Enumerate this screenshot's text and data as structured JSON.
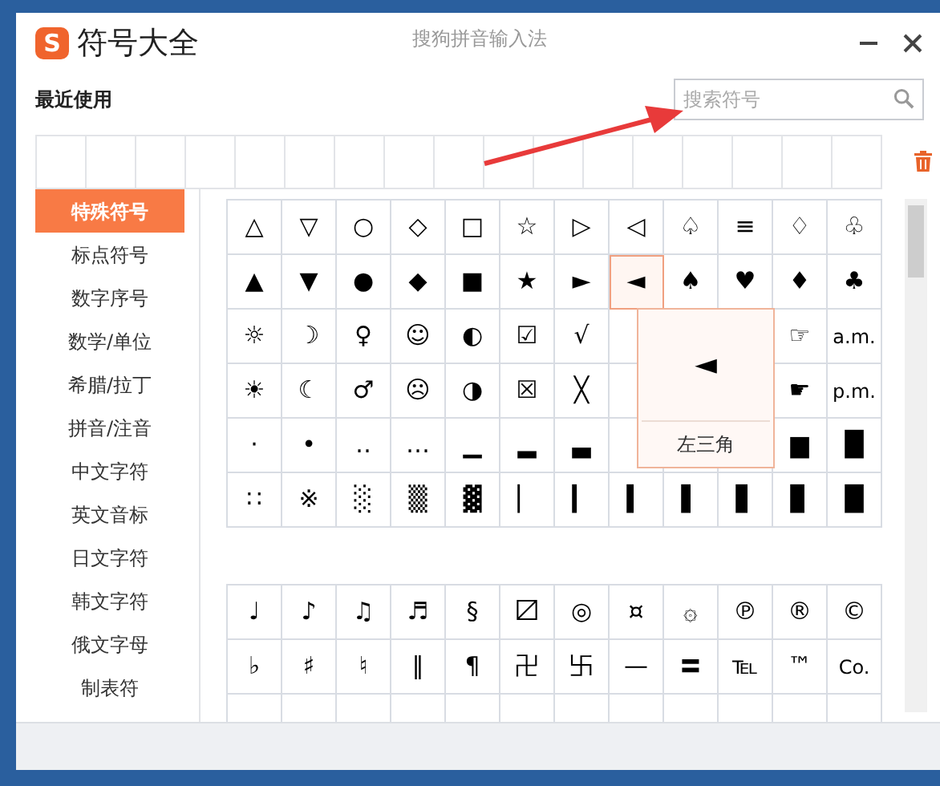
{
  "window": {
    "logo": "S",
    "title": "符号大全",
    "app_name": "搜狗拼音输入法"
  },
  "recent": {
    "label": "最近使用"
  },
  "search": {
    "placeholder": "搜索符号"
  },
  "categories": [
    {
      "label": "特殊符号",
      "selected": true
    },
    {
      "label": "标点符号",
      "selected": false
    },
    {
      "label": "数字序号",
      "selected": false
    },
    {
      "label": "数学/单位",
      "selected": false
    },
    {
      "label": "希腊/拉丁",
      "selected": false
    },
    {
      "label": "拼音/注音",
      "selected": false
    },
    {
      "label": "中文字符",
      "selected": false
    },
    {
      "label": "英文音标",
      "selected": false
    },
    {
      "label": "日文字符",
      "selected": false
    },
    {
      "label": "韩文字符",
      "selected": false
    },
    {
      "label": "俄文字母",
      "selected": false
    },
    {
      "label": "制表符",
      "selected": false
    }
  ],
  "grids": [
    {
      "rows": [
        [
          {
            "symbol": "△",
            "selected": false
          },
          {
            "symbol": "▽",
            "selected": false
          },
          {
            "symbol": "○",
            "selected": false
          },
          {
            "symbol": "◇",
            "selected": false
          },
          {
            "symbol": "□",
            "selected": false
          },
          {
            "symbol": "☆",
            "selected": false
          },
          {
            "symbol": "▷",
            "selected": false
          },
          {
            "symbol": "◁",
            "selected": false
          },
          {
            "symbol": "♤",
            "selected": false
          },
          {
            "symbol": "≡",
            "selected": false
          },
          {
            "symbol": "♢",
            "selected": false
          },
          {
            "symbol": "♧",
            "selected": false
          }
        ],
        [
          {
            "symbol": "▲",
            "selected": false
          },
          {
            "symbol": "▼",
            "selected": false
          },
          {
            "symbol": "●",
            "selected": false
          },
          {
            "symbol": "◆",
            "selected": false
          },
          {
            "symbol": "■",
            "selected": false
          },
          {
            "symbol": "★",
            "selected": false
          },
          {
            "symbol": "►",
            "selected": false
          },
          {
            "symbol": "◄",
            "selected": true
          },
          {
            "symbol": "♠",
            "selected": false
          },
          {
            "symbol": "♥",
            "selected": false
          },
          {
            "symbol": "♦",
            "selected": false
          },
          {
            "symbol": "♣",
            "selected": false
          }
        ],
        [
          {
            "symbol": "☼",
            "selected": false
          },
          {
            "symbol": "☽",
            "selected": false
          },
          {
            "symbol": "♀",
            "selected": false
          },
          {
            "symbol": "☺",
            "selected": false
          },
          {
            "symbol": "◐",
            "selected": false
          },
          {
            "symbol": "☑",
            "selected": false
          },
          {
            "symbol": "√",
            "selected": false
          },
          null,
          null,
          null,
          {
            "symbol": "☞",
            "selected": false
          },
          {
            "symbol": "a.m.",
            "selected": false
          }
        ],
        [
          {
            "symbol": "☀",
            "selected": false
          },
          {
            "symbol": "☾",
            "selected": false
          },
          {
            "symbol": "♂",
            "selected": false
          },
          {
            "symbol": "☹",
            "selected": false
          },
          {
            "symbol": "◑",
            "selected": false
          },
          {
            "symbol": "☒",
            "selected": false
          },
          {
            "symbol": "╳",
            "selected": false
          },
          null,
          null,
          null,
          {
            "symbol": "☛",
            "selected": false
          },
          {
            "symbol": "p.m.",
            "selected": false
          }
        ],
        [
          {
            "symbol": "·",
            "selected": false
          },
          {
            "symbol": "•",
            "selected": false
          },
          {
            "symbol": "‥",
            "selected": false
          },
          {
            "symbol": "…",
            "selected": false
          },
          {
            "symbol": "▁",
            "selected": false
          },
          {
            "symbol": "▂",
            "selected": false
          },
          {
            "symbol": "▃",
            "selected": false
          },
          null,
          null,
          null,
          {
            "symbol": "▆",
            "selected": false
          },
          {
            "symbol": "█",
            "selected": false
          }
        ],
        [
          {
            "symbol": "∷",
            "selected": false
          },
          {
            "symbol": "※",
            "selected": false
          },
          {
            "symbol": "░",
            "selected": false
          },
          {
            "symbol": "▒",
            "selected": false
          },
          {
            "symbol": "▓",
            "selected": false
          },
          {
            "symbol": "▏",
            "selected": false
          },
          {
            "symbol": "▎",
            "selected": false
          },
          {
            "symbol": "▍",
            "selected": false
          },
          {
            "symbol": "▌",
            "selected": false
          },
          {
            "symbol": "▋",
            "selected": false
          },
          {
            "symbol": "▊",
            "selected": false
          },
          {
            "symbol": "█",
            "selected": false
          }
        ]
      ]
    },
    {
      "rows": [
        [
          {
            "symbol": "♩",
            "selected": false
          },
          {
            "symbol": "♪",
            "selected": false
          },
          {
            "symbol": "♫",
            "selected": false
          },
          {
            "symbol": "♬",
            "selected": false
          },
          {
            "symbol": "§",
            "selected": false
          },
          {
            "symbol": "〼",
            "selected": false
          },
          {
            "symbol": "◎",
            "selected": false
          },
          {
            "symbol": "¤",
            "selected": false
          },
          {
            "symbol": "۞",
            "selected": false
          },
          {
            "symbol": "℗",
            "selected": false
          },
          {
            "symbol": "®",
            "selected": false
          },
          {
            "symbol": "©",
            "selected": false
          }
        ],
        [
          {
            "symbol": "♭",
            "selected": false
          },
          {
            "symbol": "♯",
            "selected": false
          },
          {
            "symbol": "♮",
            "selected": false
          },
          {
            "symbol": "‖",
            "selected": false
          },
          {
            "symbol": "¶",
            "selected": false
          },
          {
            "symbol": "卍",
            "selected": false
          },
          {
            "symbol": "卐",
            "selected": false
          },
          {
            "symbol": "—",
            "selected": false
          },
          {
            "symbol": "〓",
            "selected": false
          },
          {
            "symbol": "℡",
            "selected": false
          },
          {
            "symbol": "™",
            "selected": false
          },
          {
            "symbol": "Co.",
            "selected": false
          }
        ]
      ]
    }
  ],
  "preview": {
    "symbol": "◄",
    "name": "左三角"
  }
}
